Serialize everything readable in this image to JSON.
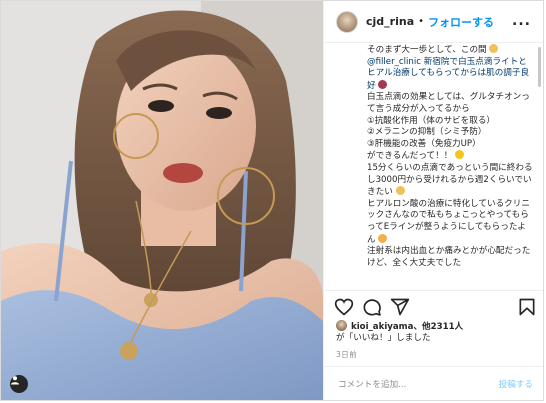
{
  "header": {
    "username": "cjd_rina",
    "separator": "•",
    "follow_label": "フォローする",
    "more_label": "..."
  },
  "caption_lines": [
    "そのまず大一歩として、この間",
    "@filler_clinic 新宿院で白玉点滴ライトとヒアル治療してもらってからは肌の調子良好",
    "白玉点滴の効果としては、グルタチオンって言う成分が入ってるから",
    "①抗酸化作用（体のサビを取る）",
    "②メラニンの抑制（シミ予防）",
    "③肝機能の改善（免疫力UP）",
    "ができるんだって！！",
    "15分くらいの点滴であっという間に終わるし3000円から受けれるから週2くらいでいきたい",
    "ヒアルロン酸の治療に特化しているクリニックさんなので私もちょこっとやってもらってEラインが整うようにしてもらったよん",
    "注射系は内出血とか痛みとかが心配だったけど、全く大丈夫でした"
  ],
  "likes": {
    "liker": "kioi_akiyama",
    "others": "、他2311人",
    "suffix": "が「いいね！」しました"
  },
  "date": "3日前",
  "comment": {
    "placeholder": "コメントを追加...",
    "post_label": "投稿する"
  },
  "colors": {
    "accent": "#0095f6",
    "text": "#262626",
    "muted": "#8e8e8e",
    "border": "#efefef"
  },
  "icons": [
    "heart-icon",
    "comment-icon",
    "share-icon",
    "bookmark-icon",
    "user-tag-icon",
    "more-icon"
  ]
}
